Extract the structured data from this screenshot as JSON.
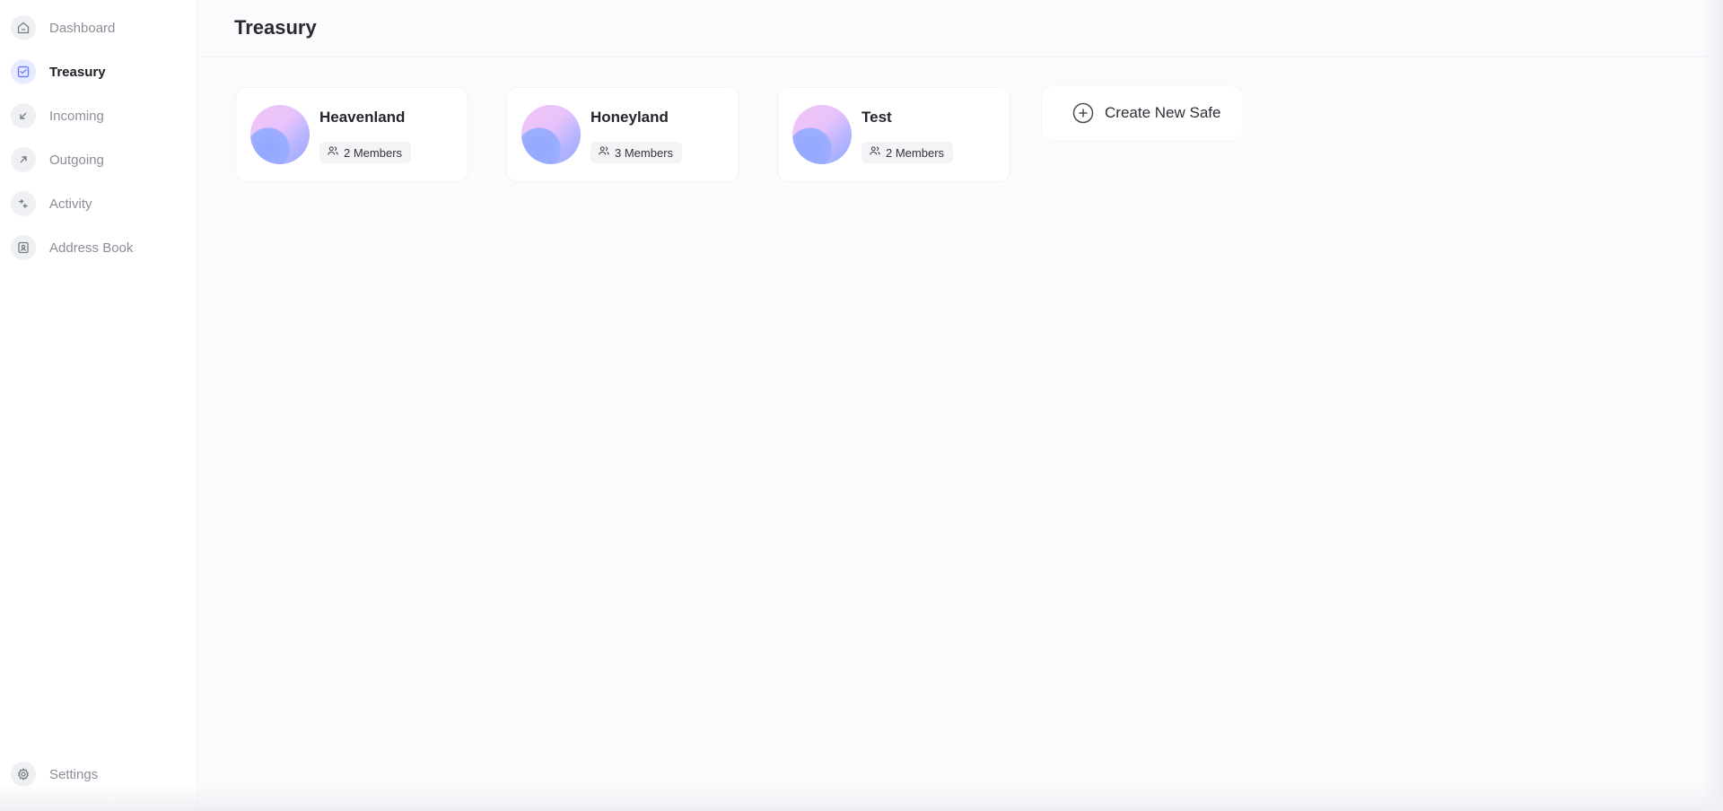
{
  "sidebar": {
    "items": [
      {
        "label": "Dashboard",
        "icon": "home-icon"
      },
      {
        "label": "Treasury",
        "icon": "treasury-icon",
        "active": true
      },
      {
        "label": "Incoming",
        "icon": "arrow-down-left-icon"
      },
      {
        "label": "Outgoing",
        "icon": "arrow-up-right-icon"
      },
      {
        "label": "Activity",
        "icon": "activity-arrows-icon"
      },
      {
        "label": "Address Book",
        "icon": "address-book-icon"
      }
    ],
    "settings_label": "Settings"
  },
  "header": {
    "title": "Treasury"
  },
  "safes": [
    {
      "name": "Heavenland",
      "members": "2 Members"
    },
    {
      "name": "Honeyland",
      "members": "3 Members"
    },
    {
      "name": "Test",
      "members": "2 Members"
    }
  ],
  "create_safe": {
    "label": "Create New Safe"
  },
  "colors": {
    "accent": "#6b7cff",
    "active_icon_bg": "#e6ebff",
    "muted_text": "#8b8e99"
  }
}
